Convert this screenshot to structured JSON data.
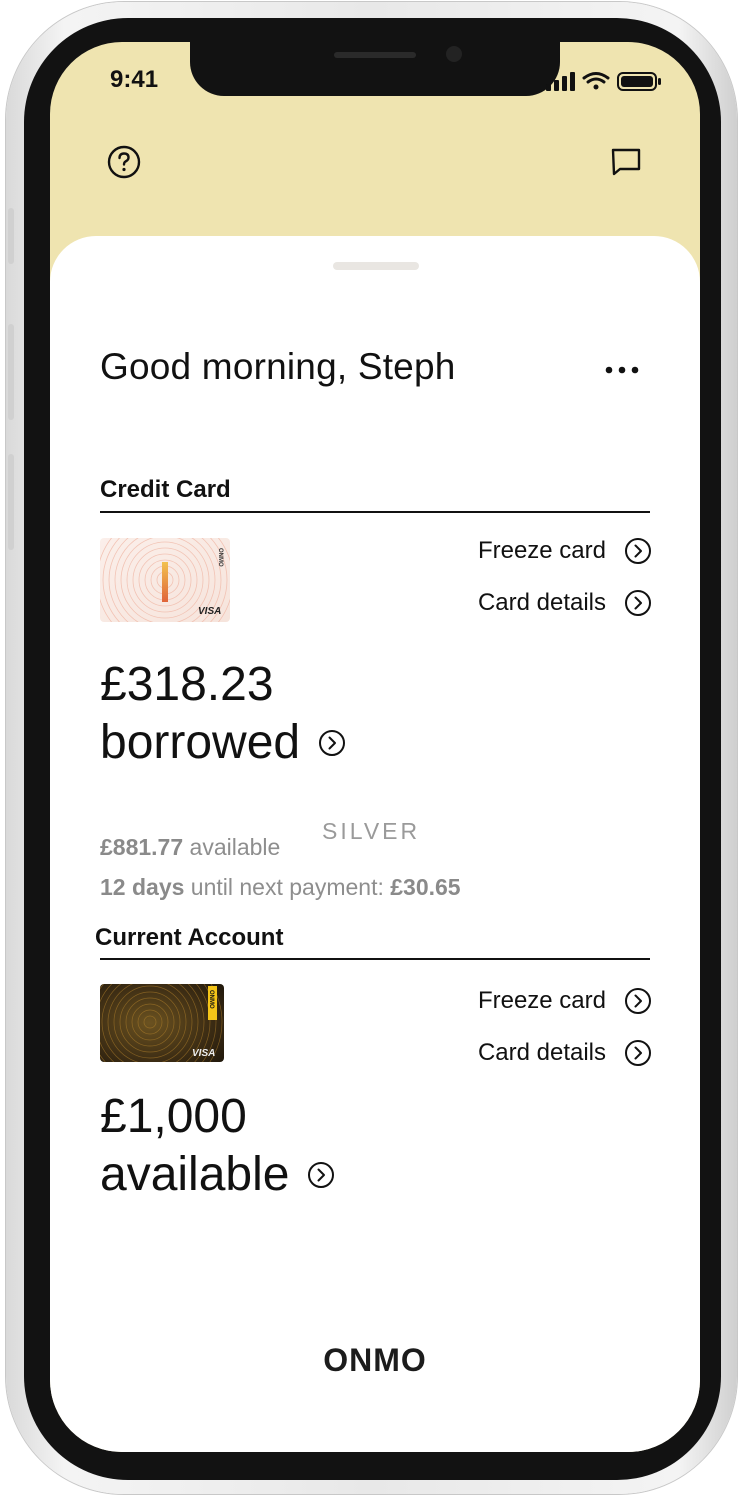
{
  "status_bar": {
    "time": "9:41",
    "icons": [
      "cellular-signal-icon",
      "wifi-icon",
      "battery-icon"
    ]
  },
  "header": {
    "left_icon": "help-circle-icon",
    "right_icon": "chat-icon"
  },
  "greeting": "Good morning, Steph",
  "more_icon": "more-dots-icon",
  "credit_card": {
    "section_title": "Credit Card",
    "card_brand": "ONMO",
    "card_network": "VISA",
    "freeze_label": "Freeze card",
    "details_label": "Card details",
    "amount": "£318.23",
    "amount_caption": "borrowed",
    "available_amount": "£881.77",
    "available_label": "available",
    "tier": "SILVER",
    "days": "12 days",
    "payment_text": "until next payment:",
    "payment_amount": "£30.65"
  },
  "current_account": {
    "section_title": "Current Account",
    "card_brand": "ONMO",
    "card_network": "VISA",
    "freeze_label": "Freeze card",
    "details_label": "Card details",
    "amount": "£1,000",
    "amount_caption": "available"
  },
  "footer": {
    "brand": "ONMO"
  },
  "colors": {
    "header_bg": "#efe4b0",
    "sheet_bg": "#ffffff",
    "text": "#111111",
    "muted": "#8e8e8e"
  }
}
